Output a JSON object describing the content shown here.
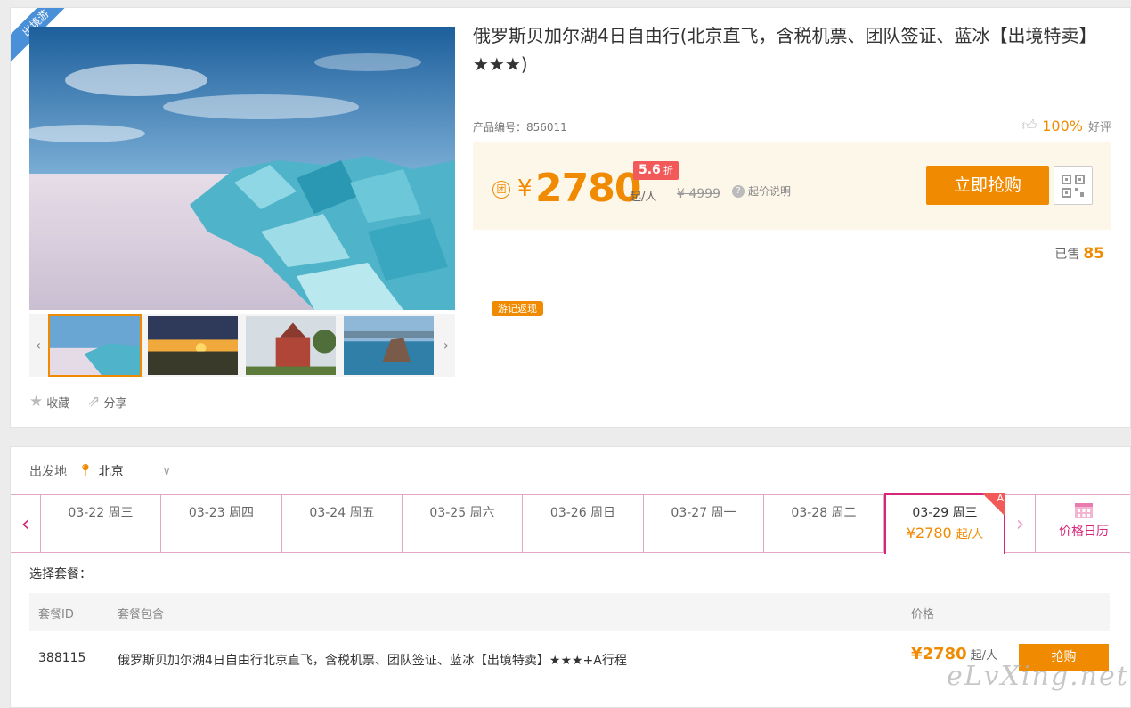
{
  "product": {
    "ribbon": "出境游",
    "title": "俄罗斯贝加尔湖4日自由行(北京直飞，含税机票、团队签证、蓝冰【出境特卖】★★★)",
    "id_label": "产品编号：856011",
    "rating_pct": "100%",
    "rating_label": "好评",
    "favorite": "收藏",
    "share": "分享",
    "tag": "游记返现",
    "images": [
      "frozen-lake-blue-ice",
      "lake-sunset",
      "red-church",
      "lake-rock-island"
    ]
  },
  "price": {
    "tuan": "团",
    "currency": "¥",
    "amount": "2780",
    "per": "起/人",
    "discount": "5.6",
    "discount_unit": "折",
    "original": "¥ 4999",
    "explain": "起价说明",
    "buy_label": "立即抢购"
  },
  "sold": {
    "label": "已售",
    "count": "85"
  },
  "booking": {
    "departure_label": "出发地",
    "departure_city": "北京",
    "dates": [
      {
        "label": "03-22 周三"
      },
      {
        "label": "03-23 周四"
      },
      {
        "label": "03-24 周五"
      },
      {
        "label": "03-25 周六"
      },
      {
        "label": "03-26 周日"
      },
      {
        "label": "03-27 周一"
      },
      {
        "label": "03-28 周二"
      },
      {
        "label": "03-29 周三",
        "price": "¥2780",
        "per": "起/人",
        "corner": "A"
      }
    ],
    "calendar_label": "价格日历",
    "select_label": "选择套餐：",
    "headers": {
      "id": "套餐ID",
      "includes": "套餐包含",
      "price": "价格"
    },
    "row": {
      "id": "388115",
      "desc": "俄罗斯贝加尔湖4日自由行北京直飞，含税机票、团队签证、蓝冰【出境特卖】★★★+A行程",
      "price": "¥2780",
      "per": "起/人",
      "action": "抢购"
    }
  },
  "watermark": "eLvXing.net",
  "colors": {
    "accent": "#f08a00",
    "date_border": "#d6267a",
    "discount": "#f25a5a"
  }
}
